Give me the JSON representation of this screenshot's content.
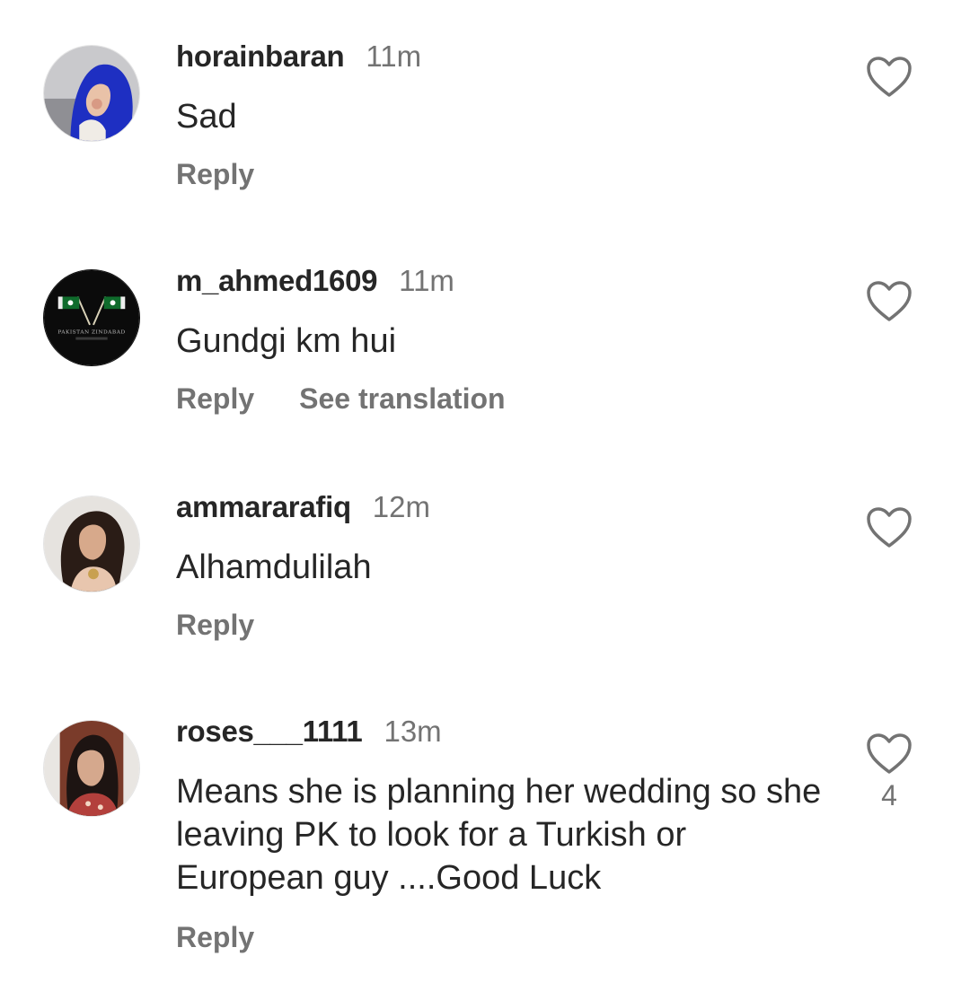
{
  "comments": [
    {
      "username": "horainbaran",
      "time": "11m",
      "text": "Sad",
      "reply_label": "Reply",
      "translate_label": null,
      "like_count": null,
      "like_icon": "heart-outline-icon"
    },
    {
      "username": "m_ahmed1609",
      "time": "11m",
      "text": "Gundgi km hui",
      "reply_label": "Reply",
      "translate_label": "See translation",
      "like_count": null,
      "like_icon": "heart-outline-icon",
      "avatar_caption": "PAKISTAN ZINDABAD"
    },
    {
      "username": "ammararafiq",
      "time": "12m",
      "text": "Alhamdulilah",
      "reply_label": "Reply",
      "translate_label": null,
      "like_count": null,
      "like_icon": "heart-outline-icon"
    },
    {
      "username": "roses___1111",
      "time": "13m",
      "text": "Means she is planning her wedding so she leaving PK to look for a Turkish or European guy ....Good Luck",
      "reply_label": "Reply",
      "translate_label": null,
      "like_count": "4",
      "like_icon": "heart-outline-icon"
    }
  ],
  "colors": {
    "primary_text": "#262626",
    "secondary_text": "#737373",
    "background": "#ffffff",
    "icon_stroke": "#737373"
  }
}
